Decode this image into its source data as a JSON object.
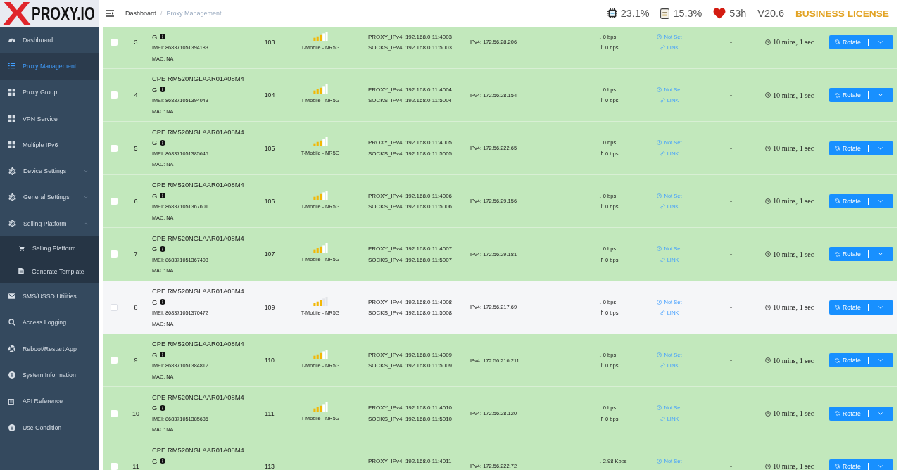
{
  "logo": {
    "accent": "X",
    "name": "PROXY.IO"
  },
  "breadcrumb": {
    "separator": "/",
    "items": [
      {
        "label": "Dashboard",
        "current": false
      },
      {
        "label": "Proxy Management",
        "current": true
      }
    ]
  },
  "stats": [
    {
      "kind": "cpu",
      "value": "23.1%"
    },
    {
      "kind": "ram",
      "value": "15.3%"
    },
    {
      "kind": "heart",
      "value": "53h"
    },
    {
      "kind": "version",
      "value": "V20.6"
    },
    {
      "kind": "license",
      "value": "BUSINESS LICENSE"
    }
  ],
  "sidebar": {
    "items": [
      {
        "label": "Dashboard",
        "selected": false
      },
      {
        "label": "Proxy Management",
        "selected": true
      },
      {
        "label": "Proxy Group",
        "selected": false
      },
      {
        "label": "VPN Service",
        "selected": false
      },
      {
        "label": "Multiple IPv6",
        "selected": false
      },
      {
        "label": "Device Settings",
        "selected": false,
        "expanded": false
      },
      {
        "label": "General Settings",
        "selected": false,
        "expanded": false
      },
      {
        "label": "Selling Platform",
        "selected": false,
        "expanded": true,
        "children": [
          {
            "label": "Selling Platform",
            "selected": false
          },
          {
            "label": "Generate Template",
            "selected": false
          }
        ]
      },
      {
        "label": "SMS/USSD Utilities",
        "selected": false
      },
      {
        "label": "Access Logging",
        "selected": false
      },
      {
        "label": "Reboot/Restart App",
        "selected": false
      },
      {
        "label": "System Information",
        "selected": false
      },
      {
        "label": "API Reference",
        "selected": false
      },
      {
        "label": "Use Condition",
        "selected": false
      }
    ]
  },
  "rows": [
    {
      "number": "3",
      "model_line2": "G",
      "imei": "IMEI: 868371051394183",
      "mac": "MAC: NA",
      "column_4": "103",
      "carrier": "T-Mobile - NR5G",
      "proxy": "PROXY_IPv4: 192.168.0.11:4003",
      "socks": "SOCKS_IPv4: 192.168.0.11:5003",
      "ipv4": "IPv4: 172.56.28.206",
      "down": "↓ 0 bps",
      "up": "↾ 0 bps",
      "schedule": "Not Set",
      "link": "LINK",
      "column_9": "-",
      "time": "10 mins, 1 sec",
      "button": "Rotate",
      "active": true,
      "checked": false
    },
    {
      "number": "4",
      "model_line1": "CPE RM520NGLAAR01A08M4",
      "model_line2": "G",
      "imei": "IMEI: 868371051394043",
      "mac": "MAC: NA",
      "column_4": "104",
      "carrier": "T-Mobile - NR5G",
      "proxy": "PROXY_IPv4: 192.168.0.11:4004",
      "socks": "SOCKS_IPv4: 192.168.0.11:5004",
      "ipv4": "IPv4: 172.56.28.154",
      "down": "↓ 0 bps",
      "up": "↾ 0 bps",
      "schedule": "Not Set",
      "link": "LINK",
      "column_9": "-",
      "time": "10 mins, 1 sec",
      "button": "Rotate",
      "active": true,
      "checked": false
    },
    {
      "number": "5",
      "model_line1": "CPE RM520NGLAAR01A08M4",
      "model_line2": "G",
      "imei": "IMEI: 868371051385645",
      "mac": "MAC: NA",
      "column_4": "105",
      "carrier": "T-Mobile - NR5G",
      "proxy": "PROXY_IPv4: 192.168.0.11:4005",
      "socks": "SOCKS_IPv4: 192.168.0.11:5005",
      "ipv4": "IPv4: 172.56.222.65",
      "down": "↓ 0 bps",
      "up": "↾ 0 bps",
      "schedule": "Not Set",
      "link": "LINK",
      "column_9": "-",
      "time": "10 mins, 1 sec",
      "button": "Rotate",
      "active": true,
      "checked": false
    },
    {
      "number": "6",
      "model_line1": "CPE RM520NGLAAR01A08M4",
      "model_line2": "G",
      "imei": "IMEI: 868371051367601",
      "mac": "MAC: NA",
      "column_4": "106",
      "carrier": "T-Mobile - NR5G",
      "proxy": "PROXY_IPv4: 192.168.0.11:4006",
      "socks": "SOCKS_IPv4: 192.168.0.11:5006",
      "ipv4": "IPv4: 172.56.29.156",
      "down": "↓ 0 bps",
      "up": "↾ 0 bps",
      "schedule": "Not Set",
      "link": "LINK",
      "column_9": "-",
      "time": "10 mins, 1 sec",
      "button": "Rotate",
      "active": true,
      "checked": false
    },
    {
      "number": "7",
      "model_line1": "CPE RM520NGLAAR01A08M4",
      "model_line2": "G",
      "imei": "IMEI: 868371051367403",
      "mac": "MAC: NA",
      "column_4": "107",
      "carrier": "T-Mobile - NR5G",
      "proxy": "PROXY_IPv4: 192.168.0.11:4007",
      "socks": "SOCKS_IPv4: 192.168.0.11:5007",
      "ipv4": "IPv4: 172.56.29.181",
      "down": "↓ 0 bps",
      "up": "↾ 0 bps",
      "schedule": "Not Set",
      "link": "LINK",
      "column_9": "-",
      "time": "10 mins, 1 sec",
      "button": "Rotate",
      "active": true,
      "checked": false
    },
    {
      "number": "8",
      "model_line1": "CPE RM520NGLAAR01A08M4",
      "model_line2": "G",
      "imei": "IMEI: 868371051370472",
      "mac": "MAC: NA",
      "column_4": "109",
      "carrier": "T-Mobile - NR5G",
      "proxy": "PROXY_IPv4: 192.168.0.11:4008",
      "socks": "SOCKS_IPv4: 192.168.0.11:5008",
      "ipv4": "IPv4: 172.56.217.69",
      "down": "↓ 0 bps",
      "up": "↾ 0 bps",
      "schedule": "Not Set",
      "link": "LINK",
      "column_9": "-",
      "time": "10 mins, 1 sec",
      "button": "Rotate",
      "active": false,
      "checked": false
    },
    {
      "number": "9",
      "model_line1": "CPE RM520NGLAAR01A08M4",
      "model_line2": "G",
      "imei": "IMEI: 868371051384812",
      "mac": "MAC: NA",
      "column_4": "110",
      "carrier": "T-Mobile - NR5G",
      "proxy": "PROXY_IPv4: 192.168.0.11:4009",
      "socks": "SOCKS_IPv4: 192.168.0.11:5009",
      "ipv4": "IPv4: 172.56.216.211",
      "down": "↓ 0 bps",
      "up": "↾ 0 bps",
      "schedule": "Not Set",
      "link": "LINK",
      "column_9": "-",
      "time": "10 mins, 1 sec",
      "button": "Rotate",
      "active": true,
      "checked": false
    },
    {
      "number": "10",
      "model_line1": "CPE RM520NGLAAR01A08M4",
      "model_line2": "G",
      "imei": "IMEI: 868371051385686",
      "mac": "MAC: NA",
      "column_4": "111",
      "carrier": "T-Mobile - NR5G",
      "proxy": "PROXY_IPv4: 192.168.0.11:4010",
      "socks": "SOCKS_IPv4: 192.168.0.11:5010",
      "ipv4": "IPv4: 172.56.28.120",
      "down": "↓ 0 bps",
      "up": "↾ 0 bps",
      "schedule": "Not Set",
      "link": "LINK",
      "column_9": "-",
      "time": "10 mins, 1 sec",
      "button": "Rotate",
      "active": true,
      "checked": false
    },
    {
      "number": "11",
      "model_line1": "CPE RM520NGLAAR01A08M4",
      "model_line2": "G",
      "column_4": "113",
      "proxy": "PROXY_IPv4: 192.168.0.11:4011",
      "ipv4": "IPv4: 172.56.222.72",
      "down": "↓ 2.98 Kbps",
      "schedule": "Not Set",
      "column_9": "-",
      "time": "10 mins, 1 sec",
      "button": "Rotate",
      "active": true,
      "checked": false
    }
  ]
}
